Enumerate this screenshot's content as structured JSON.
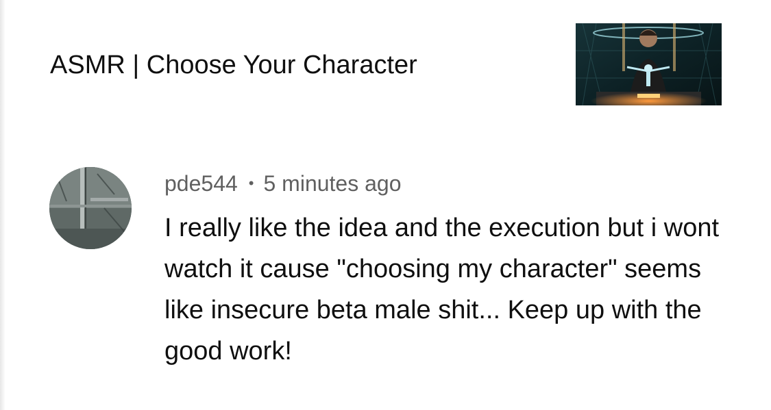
{
  "video": {
    "title": "ASMR | Choose Your Character"
  },
  "comment": {
    "author": "pde544",
    "separator": "•",
    "time": "5 minutes ago",
    "text": "I really like the idea and the execution but i wont watch it cause \"choosing my character\" seems like insecure beta male shit... Keep up with the good work!"
  }
}
